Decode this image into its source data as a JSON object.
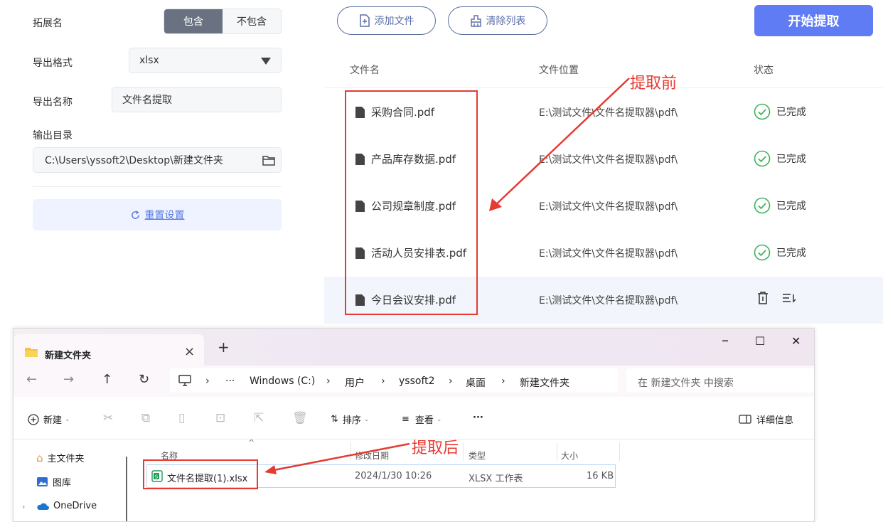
{
  "settings": {
    "ext_label": "拓展名",
    "include_label": "包含",
    "exclude_label": "不包含",
    "format_label": "导出格式",
    "format_value": "xlsx",
    "export_name_label": "导出名称",
    "export_name_value": "文件名提取",
    "output_dir_label": "输出目录",
    "output_dir_value": "C:\\Users\\yssoft2\\Desktop\\新建文件夹",
    "reset_label": "重置设置"
  },
  "actions": {
    "add_file": "添加文件",
    "clear_list": "清除列表",
    "start": "开始提取"
  },
  "table": {
    "headers": {
      "name": "文件名",
      "location": "文件位置",
      "status": "状态"
    },
    "rows": [
      {
        "name": "采购合同.pdf",
        "location": "E:\\测试文件\\文件名提取器\\pdf\\",
        "status": "已完成"
      },
      {
        "name": "产品库存数据.pdf",
        "location": "E:\\测试文件\\文件名提取器\\pdf\\",
        "status": "已完成"
      },
      {
        "name": "公司规章制度.pdf",
        "location": "E:\\测试文件\\文件名提取器\\pdf\\",
        "status": "已完成"
      },
      {
        "name": "活动人员安排表.pdf",
        "location": "E:\\测试文件\\文件名提取器\\pdf\\",
        "status": "已完成"
      },
      {
        "name": "今日会议安排.pdf",
        "location": "E:\\测试文件\\文件名提取器\\pdf\\",
        "status": ""
      }
    ]
  },
  "annotations": {
    "before": "提取前",
    "after": "提取后",
    "color": "#e63a32"
  },
  "explorer": {
    "tab_title": "新建文件夹",
    "tab_close": "×",
    "tab_add": "+",
    "win_min": "–",
    "win_max": "☐",
    "win_close": "✕",
    "breadcrumbs": [
      "Windows (C:)",
      "用户",
      "yssoft2",
      "桌面",
      "新建文件夹"
    ],
    "ellipsis": "···",
    "search_placeholder": "在 新建文件夹 中搜索",
    "toolbar": {
      "new": "新建",
      "sort": "排序",
      "view": "查看",
      "more": "···",
      "details": "详细信息"
    },
    "sidebar": [
      "主文件夹",
      "图库",
      "OneDrive"
    ],
    "columns": {
      "name": "名称",
      "modified": "修改日期",
      "type": "类型",
      "size": "大小"
    },
    "file": {
      "name": "文件名提取(1).xlsx",
      "modified": "2024/1/30 10:26",
      "type": "XLSX 工作表",
      "size": "16 KB"
    }
  },
  "colors": {
    "accent": "#5f7cf5",
    "success": "#3cb55a",
    "segment_active": "#6a7282"
  }
}
